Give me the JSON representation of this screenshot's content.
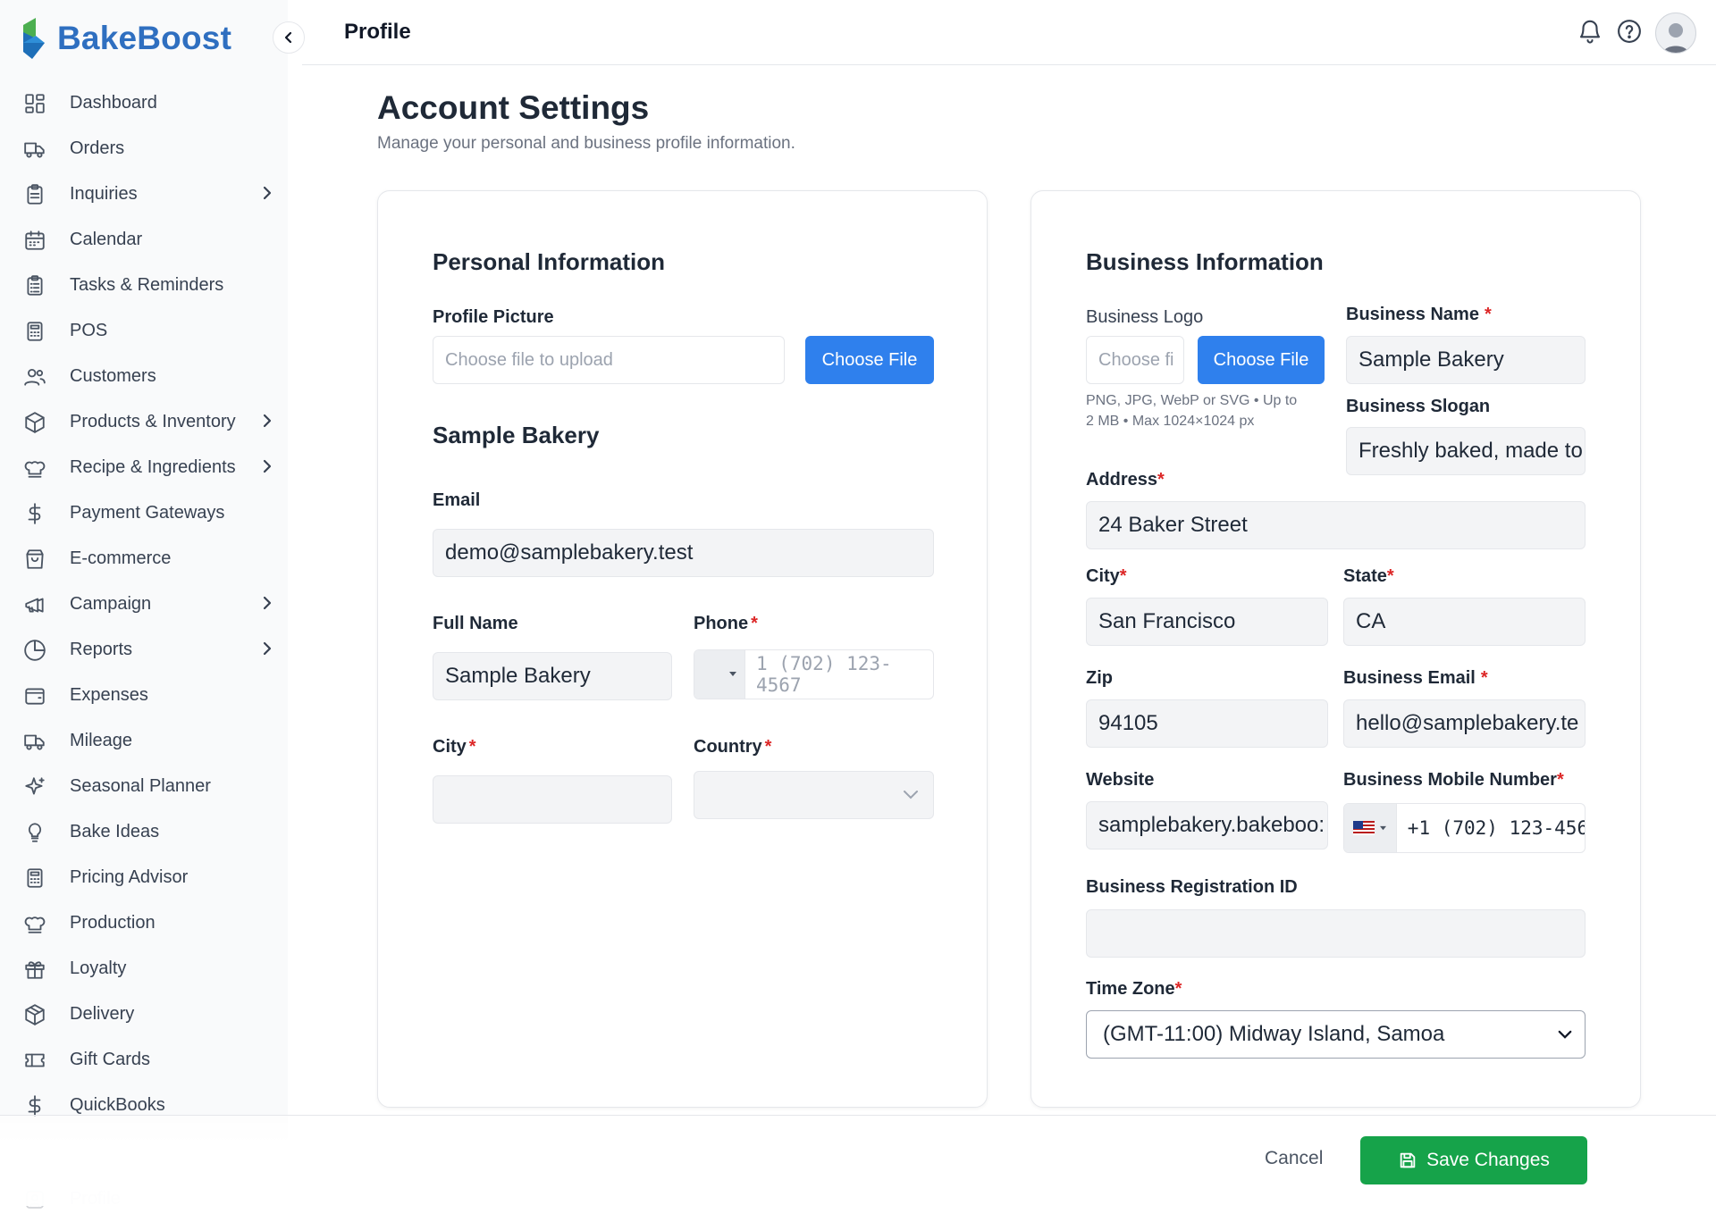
{
  "brand": {
    "name_part1": "Bake",
    "name_part2": "Boost"
  },
  "header": {
    "title": "Profile"
  },
  "sidebar": {
    "items": [
      {
        "label": "Dashboard",
        "icon": "grid-icon",
        "has_children": false
      },
      {
        "label": "Orders",
        "icon": "truck-icon",
        "has_children": false
      },
      {
        "label": "Inquiries",
        "icon": "clipboard-icon",
        "has_children": true
      },
      {
        "label": "Calendar",
        "icon": "calendar-icon",
        "has_children": false
      },
      {
        "label": "Tasks & Reminders",
        "icon": "clipboard-list-icon",
        "has_children": false
      },
      {
        "label": "POS",
        "icon": "calculator-icon",
        "has_children": false
      },
      {
        "label": "Customers",
        "icon": "users-icon",
        "has_children": false
      },
      {
        "label": "Products & Inventory",
        "icon": "box-icon",
        "has_children": true
      },
      {
        "label": "Recipe & Ingredients",
        "icon": "chef-hat-icon",
        "has_children": true
      },
      {
        "label": "Payment Gateways",
        "icon": "dollar-icon",
        "has_children": false
      },
      {
        "label": "E-commerce",
        "icon": "shopping-bag-icon",
        "has_children": false
      },
      {
        "label": "Campaign",
        "icon": "megaphone-icon",
        "has_children": true
      },
      {
        "label": "Reports",
        "icon": "pie-chart-icon",
        "has_children": true
      },
      {
        "label": "Expenses",
        "icon": "wallet-icon",
        "has_children": false
      },
      {
        "label": "Mileage",
        "icon": "truck-icon",
        "has_children": false
      },
      {
        "label": "Seasonal Planner",
        "icon": "sparkles-icon",
        "has_children": false
      },
      {
        "label": "Bake Ideas",
        "icon": "lightbulb-icon",
        "has_children": false
      },
      {
        "label": "Pricing Advisor",
        "icon": "calculator-icon",
        "has_children": false
      },
      {
        "label": "Production",
        "icon": "chef-hat-icon",
        "has_children": false
      },
      {
        "label": "Loyalty",
        "icon": "gift-icon",
        "has_children": false
      },
      {
        "label": "Delivery",
        "icon": "package-icon",
        "has_children": false
      },
      {
        "label": "Gift Cards",
        "icon": "ticket-icon",
        "has_children": false
      },
      {
        "label": "QuickBooks",
        "icon": "dollar-icon",
        "has_children": false
      }
    ],
    "faded_item": {
      "label": "Profile",
      "icon": "user-icon"
    }
  },
  "page": {
    "heading": "Account Settings",
    "subheading": "Manage your personal and business profile information."
  },
  "personal": {
    "title": "Personal Information",
    "profile_picture_label": "Profile Picture",
    "file_placeholder": "Choose file to upload",
    "choose_file": "Choose File",
    "display_name": "Sample Bakery",
    "email_label": "Email",
    "email_value": "demo@samplebakery.test",
    "full_name_label": "Full Name",
    "full_name_value": "Sample Bakery",
    "phone_label": "Phone",
    "phone_placeholder": "1 (702) 123-4567",
    "city_label": "City",
    "city_value": "",
    "country_label": "Country",
    "country_value": "",
    "required_mark": "*"
  },
  "business": {
    "title": "Business Information",
    "logo_label": "Business Logo",
    "logo_file_placeholder": "Choose fi",
    "choose_file": "Choose File",
    "logo_hint_line1": "PNG, JPG, WebP or SVG • Up to",
    "logo_hint_line2": "2 MB • Max 1024×1024 px",
    "name_label": "Business Name",
    "name_value": "Sample Bakery",
    "slogan_label": "Business Slogan",
    "slogan_value": "Freshly baked, made to",
    "address_label": "Address",
    "address_value": "24 Baker Street",
    "city_label": "City",
    "city_value": "San Francisco",
    "state_label": "State",
    "state_value": "CA",
    "zip_label": "Zip",
    "zip_value": "94105",
    "email_label": "Business Email",
    "email_value": "hello@samplebakery.te",
    "website_label": "Website",
    "website_value": "samplebakery.bakeboo:",
    "mobile_label": "Business Mobile Number",
    "mobile_value": "+1 (702) 123-456",
    "registration_label": "Business Registration ID",
    "registration_value": "",
    "timezone_label": "Time Zone",
    "timezone_value": "(GMT-11:00) Midway Island, Samoa",
    "required_mark": "*"
  },
  "footer": {
    "cancel_label": "Cancel",
    "save_label": "Save Changes"
  },
  "colors": {
    "primary_blue": "#2f80ed",
    "brand_blue": "#2f6fc0",
    "brand_green": "#4caf50",
    "save_green": "#16a34a",
    "required_red": "#dc2626"
  }
}
